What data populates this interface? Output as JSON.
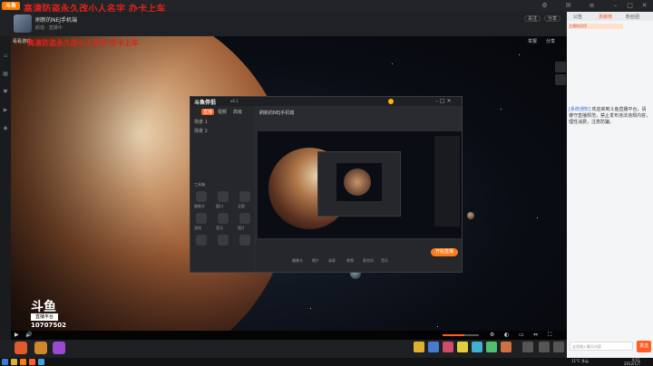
{
  "overlay_text": "高清防盗永久改小人名字 办卡上车",
  "overlay_text_small": "高清防盗永久改小人名字 办卡上车",
  "app": {
    "logo": "斗鱼"
  },
  "room": {
    "title": "刷新的NEJ手机端",
    "meta": "颜值 · 直播中",
    "streamer_tag": "看看游戏",
    "buttons": [
      "关注",
      "分享"
    ]
  },
  "video": {
    "top_right_a": "举报",
    "top_right_b": "分享"
  },
  "watermark": {
    "logo": "斗鱼",
    "tag": "直播平台",
    "room_id": "10707502"
  },
  "obs": {
    "title": "斗鱼伴侣",
    "version": "v6.1",
    "tabs": [
      "直播",
      "视频",
      "高级"
    ],
    "scenes": [
      "场景 1",
      "场景 2"
    ],
    "preview_title": "刷新的NEJ手机端",
    "tool_labels": [
      "工具箱",
      "摄像头",
      "窗口",
      "全屏",
      "游戏",
      "音乐",
      "图片",
      "文字",
      "更多"
    ],
    "bottom_labels": [
      "摄像头",
      "图片",
      "录屏",
      "视频",
      "麦克风",
      "音乐"
    ],
    "start_label": "开始直播"
  },
  "right_panel": {
    "tabs": [
      "公告",
      "贡献榜",
      "粉丝团"
    ],
    "rank_text": "主播粉丝榜",
    "chat_user": "[系统通知]",
    "chat_text": "欢迎来到斗鱼直播平台，请遵守直播规范，禁止发布违法违规内容，理性消费，注意防骗。",
    "input_placeholder": "这里输入聊天内容",
    "send_label": "发送"
  },
  "controls": {
    "play": "▶",
    "volume": "🔊"
  },
  "taskbar": {
    "weather": "11°C 多云",
    "time": "9:51",
    "date": "2022/1/7"
  }
}
